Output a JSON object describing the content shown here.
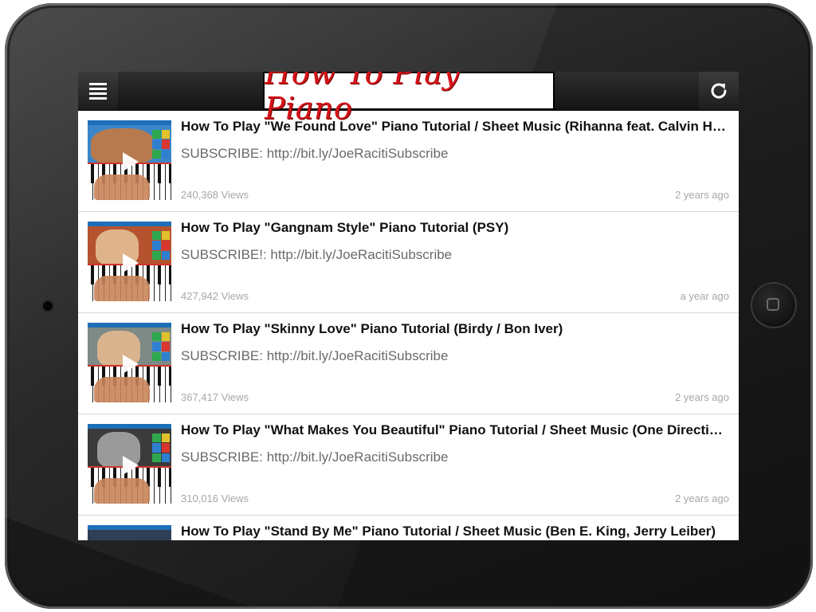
{
  "header": {
    "logo_text": "How To Play Piano",
    "menu_icon": "menu-icon",
    "refresh_icon": "refresh-icon"
  },
  "colors": {
    "logo_red": "#d4141a",
    "toolbar": "#1e1e1e",
    "meta_text": "#a7a7a7"
  },
  "videos": [
    {
      "title": "How To Play \"We Found Love\" Piano Tutorial / Sheet Music (Rihanna feat. Calvin Harris)",
      "description": "SUBSCRIBE: http://bit.ly/JoeRacitiSubscribe",
      "views": "240,368 Views",
      "age": "2 years ago"
    },
    {
      "title": "How To Play \"Gangnam Style\" Piano Tutorial (PSY)",
      "description": "SUBSCRIBE!: http://bit.ly/JoeRacitiSubscribe",
      "views": "427,942 Views",
      "age": "a year ago"
    },
    {
      "title": "How To Play \"Skinny Love\" Piano Tutorial (Birdy / Bon Iver)",
      "description": "SUBSCRIBE: http://bit.ly/JoeRacitiSubscribe",
      "views": "367,417 Views",
      "age": "2 years ago"
    },
    {
      "title": "How To Play \"What Makes You Beautiful\" Piano Tutorial / Sheet Music (One Direction)",
      "description": "SUBSCRIBE: http://bit.ly/JoeRacitiSubscribe",
      "views": "310,016 Views",
      "age": "2 years ago"
    },
    {
      "title": "How To Play \"Stand By Me\" Piano Tutorial / Sheet Music (Ben E. King, Jerry Leiber)",
      "description": "",
      "views": "",
      "age": ""
    }
  ]
}
